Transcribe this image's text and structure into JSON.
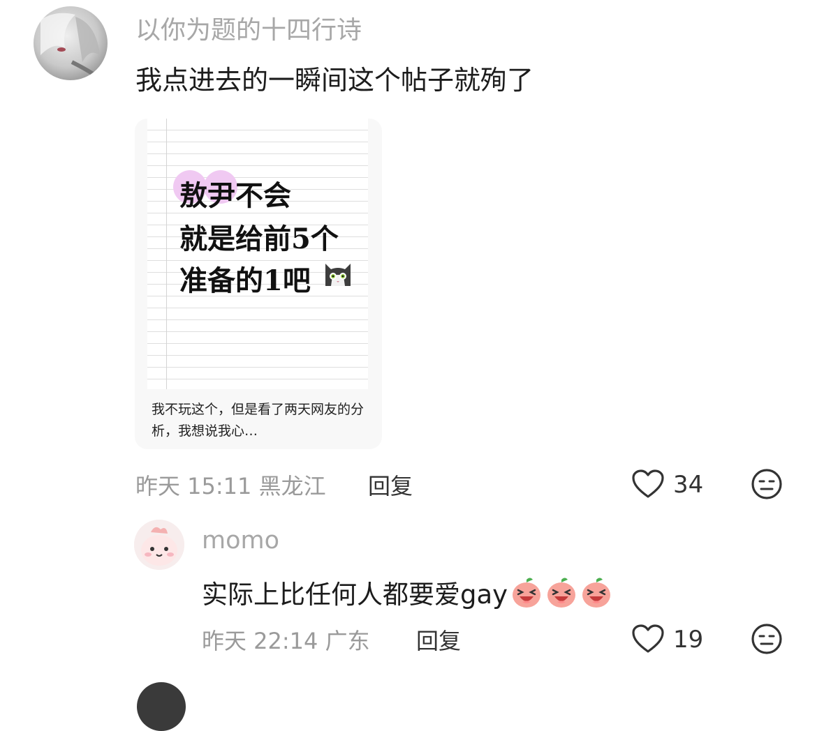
{
  "comment": {
    "username": "以你为题的十四行诗",
    "text": "我点进去的一瞬间这个帖子就殉了",
    "card": {
      "headline_lines": [
        "敖尹不会",
        "就是给前5个",
        "准备的1吧"
      ],
      "snippet": "我不玩这个，但是看了两天网友的分析，我想说我心…"
    },
    "time": "昨天 15:11",
    "location": "黑龙江",
    "reply_label": "回复",
    "likes": "34"
  },
  "reply": {
    "username": "momo",
    "text": "实际上比任何人都要爱gay",
    "emojis": [
      "peach-laugh-emoji",
      "peach-laugh-emoji",
      "peach-laugh-emoji"
    ],
    "time": "昨天 22:14",
    "location": "广东",
    "reply_label": "回复",
    "likes": "19"
  },
  "colors": {
    "muted": "#a7a7a7",
    "text": "#1c1c1c",
    "highlight": "#f0c9f2"
  }
}
